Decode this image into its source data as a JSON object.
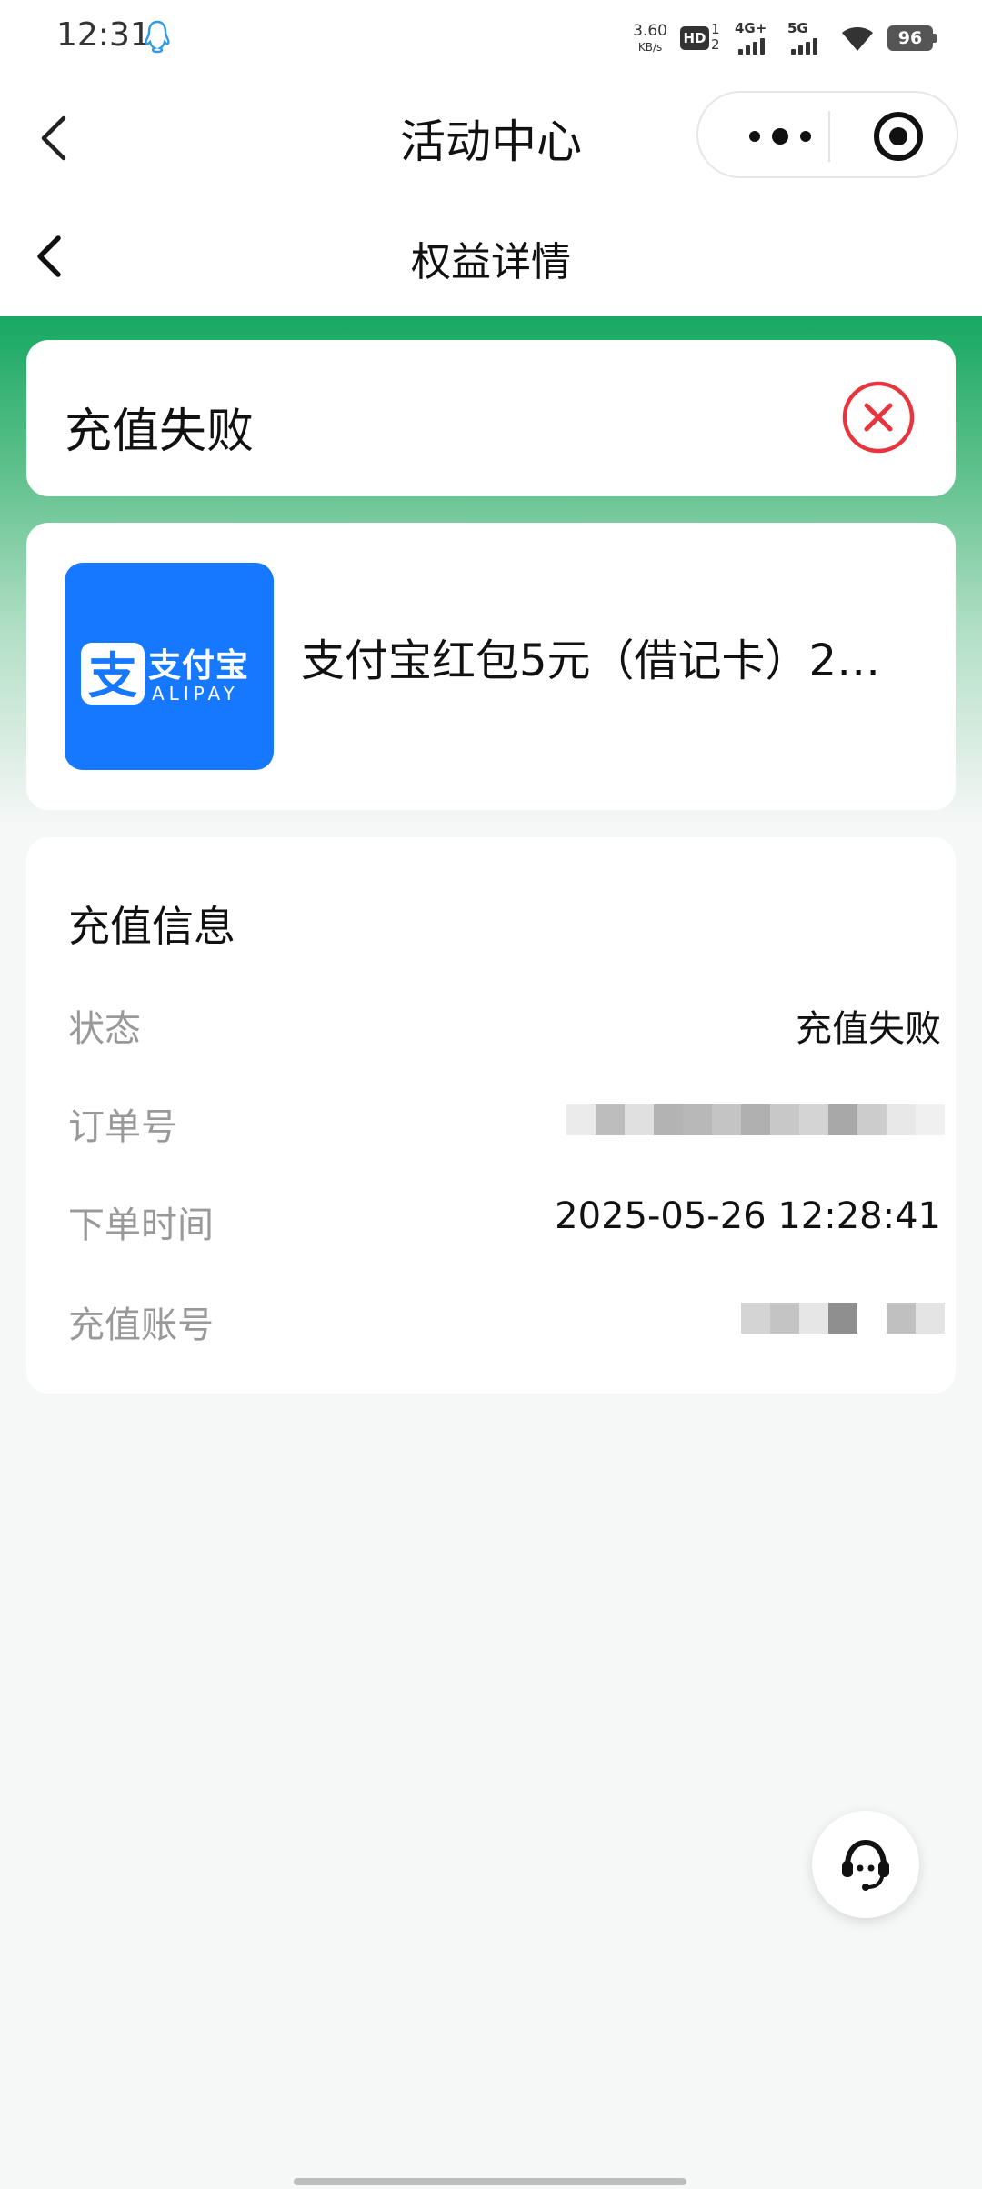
{
  "status_bar": {
    "time": "12:31",
    "net_speed_value": "3.60",
    "net_speed_unit": "KB/s",
    "hd_label": "HD",
    "hd_sim1": "1",
    "hd_sim2": "2",
    "signal1_label": "4G+",
    "signal2_label": "5G",
    "battery": "96",
    "icons": [
      "qq-icon",
      "hd-icon",
      "signal-icon",
      "wifi-icon",
      "battery-icon"
    ]
  },
  "mini_program": {
    "title": "活动中心",
    "capsule_icons": [
      "more-icon",
      "close-target-icon"
    ]
  },
  "page": {
    "title": "权益详情"
  },
  "status_card": {
    "text": "充值失败",
    "icon": "fail-x-icon",
    "accent_color": "#e8343c"
  },
  "product": {
    "logo_text_cn": "支付宝",
    "logo_text_en": "ALIPAY",
    "name": "支付宝红包5元（借记卡）2…",
    "brand_color": "#1677ff"
  },
  "info": {
    "title": "充值信息",
    "rows": [
      {
        "label": "状态",
        "value": "充值失败"
      },
      {
        "label": "订单号",
        "value": ""
      },
      {
        "label": "下单时间",
        "value": "2025-05-26  12:28:41"
      },
      {
        "label": "充值账号",
        "value": ""
      }
    ]
  },
  "theme": {
    "header_green": "#17a862",
    "page_bg": "#f6f7f7"
  },
  "floating": {
    "icon": "customer-service-icon"
  }
}
